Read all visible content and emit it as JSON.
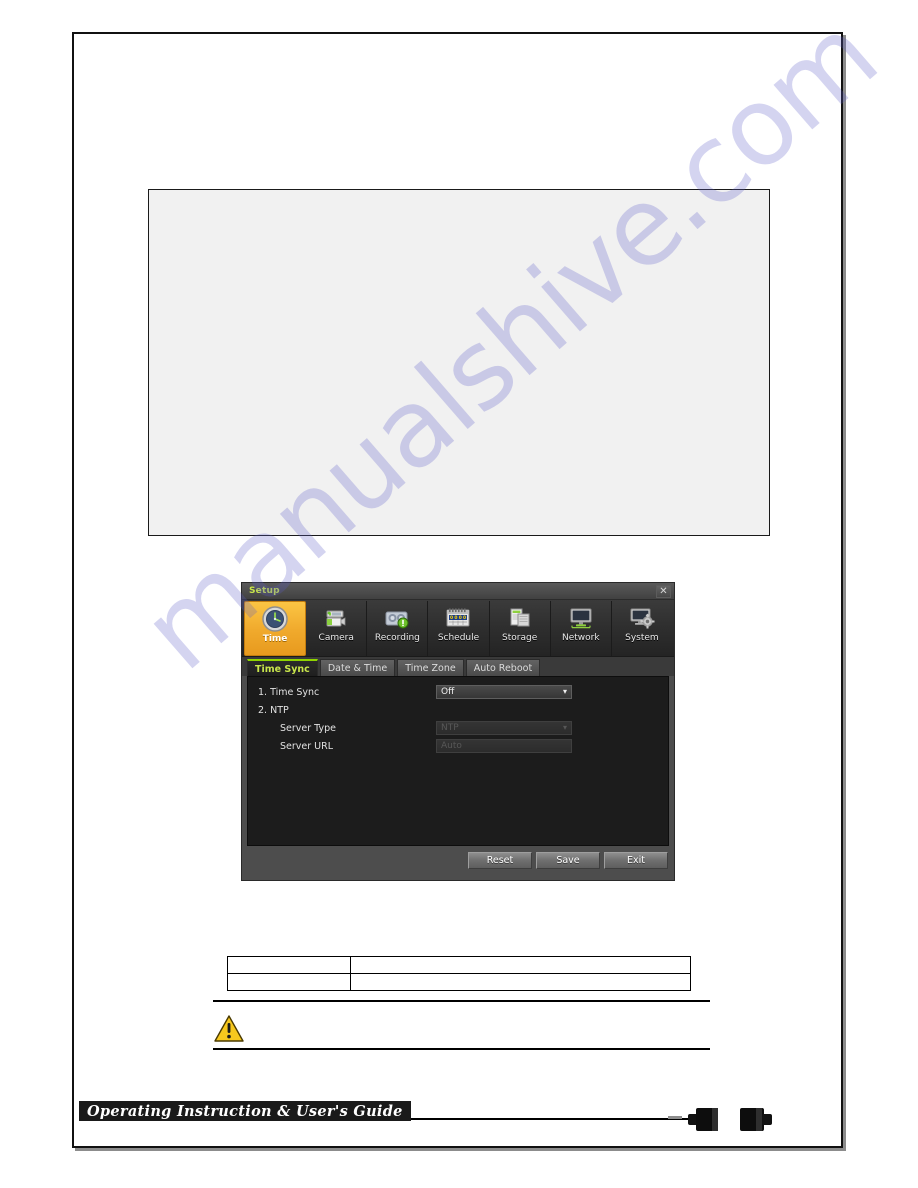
{
  "document": {
    "watermark": "manualshive.com",
    "footer": {
      "banner_text": "Operating Instruction & User's Guide",
      "page_number": ""
    },
    "figure_box": {
      "caption": ""
    },
    "spec_table": {
      "rows": [
        {
          "key": "",
          "value": ""
        },
        {
          "key": "",
          "value": ""
        }
      ]
    },
    "note": {
      "warning_icon": "warning-triangle-icon",
      "text": ""
    }
  },
  "setup_dialog": {
    "title": "Setup",
    "close_label": "✕",
    "toolbar": {
      "items": [
        {
          "label": "Time",
          "icon": "clock-icon",
          "active": true
        },
        {
          "label": "Camera",
          "icon": "camera-icon",
          "active": false
        },
        {
          "label": "Recording",
          "icon": "recording-icon",
          "active": false
        },
        {
          "label": "Schedule",
          "icon": "calendar-icon",
          "active": false
        },
        {
          "label": "Storage",
          "icon": "storage-icon",
          "active": false
        },
        {
          "label": "Network",
          "icon": "network-icon",
          "active": false
        },
        {
          "label": "System",
          "icon": "system-gear-icon",
          "active": false
        }
      ]
    },
    "subtabs": [
      {
        "label": "Time Sync",
        "active": true
      },
      {
        "label": "Date & Time",
        "active": false
      },
      {
        "label": "Time Zone",
        "active": false
      },
      {
        "label": "Auto Reboot",
        "active": false
      }
    ],
    "form": {
      "time_sync": {
        "label": "1. Time Sync",
        "value": "Off",
        "enabled": true
      },
      "ntp_heading": "2. NTP",
      "server_type": {
        "label": "Server Type",
        "value": "NTP",
        "enabled": false
      },
      "server_url": {
        "label": "Server URL",
        "value": "Auto",
        "enabled": false
      }
    },
    "buttons": {
      "reset": "Reset",
      "save": "Save",
      "exit": "Exit"
    },
    "colors": {
      "accent": "#f0a92c",
      "active_text": "#c8e64b",
      "panel_bg": "#1c1c1c",
      "dialog_bg": "#4d4d4d"
    }
  }
}
